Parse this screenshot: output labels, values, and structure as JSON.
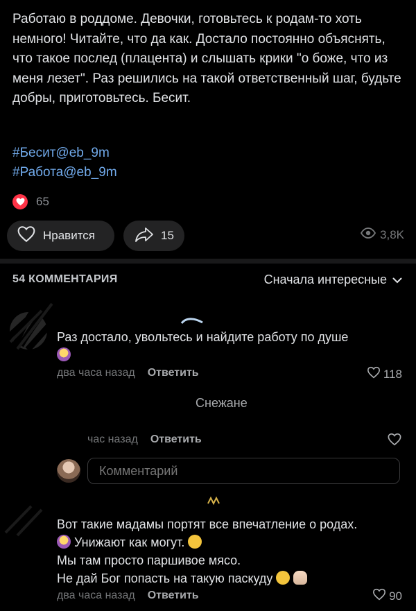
{
  "post": {
    "text": "Работаю в роддоме. Девочки, готовьтесь к родам-то хоть немного! Читайте, что да как. Достало постоянно объяснять, что такое послед (плацента) и слышать крики \"о боже, что из меня лезет\". Раз решились на такой ответственный шаг, будьте добры, приготовьтесь. Бесит.",
    "tags": [
      "#Бесит@eb_9m",
      "#Работа@eb_9m"
    ],
    "reactions_count": "65",
    "like_label": "Нравится",
    "shares_count": "15",
    "views": "3,8K"
  },
  "comments_section": {
    "count_label": "54 КОММЕНТАРИЯ",
    "sort_label": "Сначала интересные"
  },
  "comments": [
    {
      "text": "Раз достало, увольтесь и найдите работу по душе",
      "time": "два часа назад",
      "reply_label": "Ответить",
      "likes": "118"
    },
    {
      "reply_to": "Снежане",
      "time": "час назад",
      "reply_label": "Ответить"
    },
    {
      "lines": [
        "Вот такие мадамы портят все впечатление о родах.",
        "Унижают как могут.",
        "Мы там просто паршивое мясо.",
        "Не дай Бог попасть на такую паскуду"
      ],
      "time": "два часа назад",
      "reply_label": "Ответить",
      "likes": "90"
    }
  ],
  "comment_input": {
    "placeholder": "Комментарий"
  },
  "colors": {
    "background": "#000000",
    "link": "#71aaeb",
    "heart": "#ff3347",
    "pill": "#232324"
  }
}
